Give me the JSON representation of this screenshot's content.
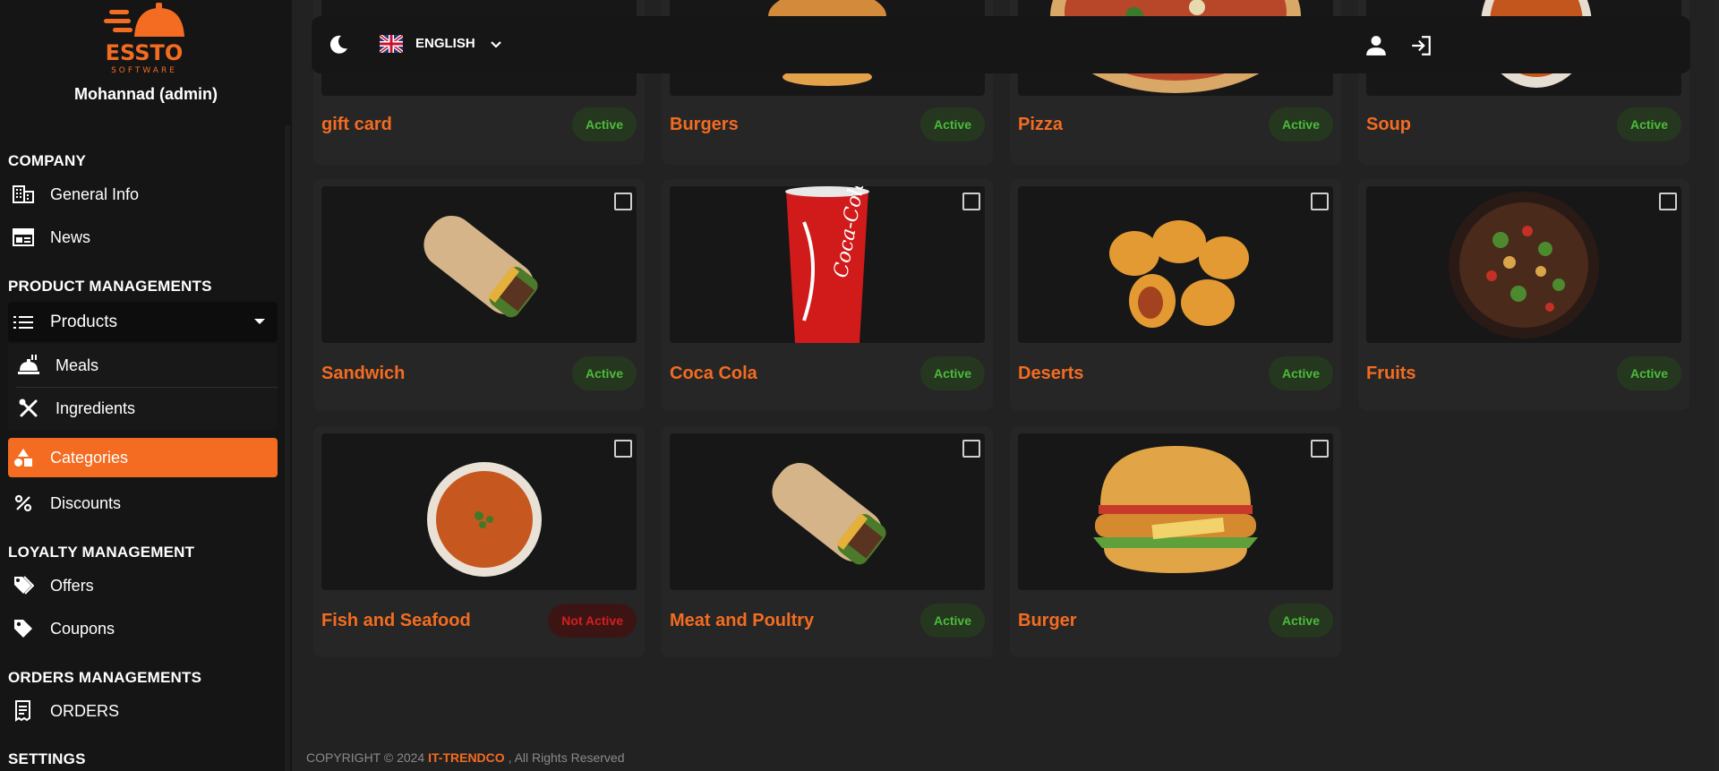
{
  "user": {
    "name": "Mohannad (admin)"
  },
  "logo": {
    "text": "ESSTO",
    "sub": "SOFTWARE"
  },
  "sidebar": {
    "company_title": "COMPANY",
    "general_info": "General Info",
    "news": "News",
    "product_title": "PRODUCT MANAGEMENTS",
    "products": "Products",
    "meals": "Meals",
    "ingredients": "Ingredients",
    "categories": "Categories",
    "discounts": "Discounts",
    "loyalty_title": "LOYALTY MANAGEMENT",
    "offers": "Offers",
    "coupons": "Coupons",
    "orders_title": "ORDERS MANAGEMENTS",
    "orders": "ORDERS",
    "settings_title": "SETTINGS"
  },
  "topbar": {
    "language": "ENGLISH"
  },
  "categories": [
    {
      "name": "gift card",
      "status": "Active"
    },
    {
      "name": "Burgers",
      "status": "Active"
    },
    {
      "name": "Pizza",
      "status": "Active"
    },
    {
      "name": "Soup",
      "status": "Active"
    },
    {
      "name": "Sandwich",
      "status": "Active"
    },
    {
      "name": "Coca Cola",
      "status": "Active"
    },
    {
      "name": "Deserts",
      "status": "Active"
    },
    {
      "name": "Fruits",
      "status": "Active"
    },
    {
      "name": "Fish and Seafood",
      "status": "Not Active"
    },
    {
      "name": "Meat and Poultry",
      "status": "Active"
    },
    {
      "name": "Burger",
      "status": "Active"
    }
  ],
  "footer": {
    "prefix": "COPYRIGHT © 2024",
    "brand": "IT-TRENDCO",
    "suffix": ", All Rights Reserved"
  },
  "colors": {
    "accent": "#f36c21",
    "active_badge": "#4cbb3a",
    "inactive_badge": "#d31f1f"
  }
}
